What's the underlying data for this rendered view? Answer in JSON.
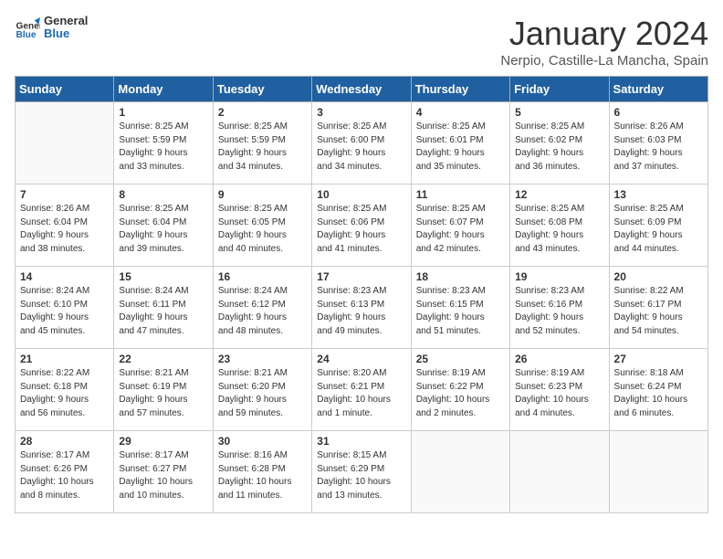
{
  "logo": {
    "text_general": "General",
    "text_blue": "Blue"
  },
  "title": "January 2024",
  "subtitle": "Nerpio, Castille-La Mancha, Spain",
  "headers": [
    "Sunday",
    "Monday",
    "Tuesday",
    "Wednesday",
    "Thursday",
    "Friday",
    "Saturday"
  ],
  "weeks": [
    [
      {
        "day": "",
        "info": ""
      },
      {
        "day": "1",
        "info": "Sunrise: 8:25 AM\nSunset: 5:59 PM\nDaylight: 9 hours\nand 33 minutes."
      },
      {
        "day": "2",
        "info": "Sunrise: 8:25 AM\nSunset: 5:59 PM\nDaylight: 9 hours\nand 34 minutes."
      },
      {
        "day": "3",
        "info": "Sunrise: 8:25 AM\nSunset: 6:00 PM\nDaylight: 9 hours\nand 34 minutes."
      },
      {
        "day": "4",
        "info": "Sunrise: 8:25 AM\nSunset: 6:01 PM\nDaylight: 9 hours\nand 35 minutes."
      },
      {
        "day": "5",
        "info": "Sunrise: 8:25 AM\nSunset: 6:02 PM\nDaylight: 9 hours\nand 36 minutes."
      },
      {
        "day": "6",
        "info": "Sunrise: 8:26 AM\nSunset: 6:03 PM\nDaylight: 9 hours\nand 37 minutes."
      }
    ],
    [
      {
        "day": "7",
        "info": "Sunrise: 8:26 AM\nSunset: 6:04 PM\nDaylight: 9 hours\nand 38 minutes."
      },
      {
        "day": "8",
        "info": "Sunrise: 8:25 AM\nSunset: 6:04 PM\nDaylight: 9 hours\nand 39 minutes."
      },
      {
        "day": "9",
        "info": "Sunrise: 8:25 AM\nSunset: 6:05 PM\nDaylight: 9 hours\nand 40 minutes."
      },
      {
        "day": "10",
        "info": "Sunrise: 8:25 AM\nSunset: 6:06 PM\nDaylight: 9 hours\nand 41 minutes."
      },
      {
        "day": "11",
        "info": "Sunrise: 8:25 AM\nSunset: 6:07 PM\nDaylight: 9 hours\nand 42 minutes."
      },
      {
        "day": "12",
        "info": "Sunrise: 8:25 AM\nSunset: 6:08 PM\nDaylight: 9 hours\nand 43 minutes."
      },
      {
        "day": "13",
        "info": "Sunrise: 8:25 AM\nSunset: 6:09 PM\nDaylight: 9 hours\nand 44 minutes."
      }
    ],
    [
      {
        "day": "14",
        "info": "Sunrise: 8:24 AM\nSunset: 6:10 PM\nDaylight: 9 hours\nand 45 minutes."
      },
      {
        "day": "15",
        "info": "Sunrise: 8:24 AM\nSunset: 6:11 PM\nDaylight: 9 hours\nand 47 minutes."
      },
      {
        "day": "16",
        "info": "Sunrise: 8:24 AM\nSunset: 6:12 PM\nDaylight: 9 hours\nand 48 minutes."
      },
      {
        "day": "17",
        "info": "Sunrise: 8:23 AM\nSunset: 6:13 PM\nDaylight: 9 hours\nand 49 minutes."
      },
      {
        "day": "18",
        "info": "Sunrise: 8:23 AM\nSunset: 6:15 PM\nDaylight: 9 hours\nand 51 minutes."
      },
      {
        "day": "19",
        "info": "Sunrise: 8:23 AM\nSunset: 6:16 PM\nDaylight: 9 hours\nand 52 minutes."
      },
      {
        "day": "20",
        "info": "Sunrise: 8:22 AM\nSunset: 6:17 PM\nDaylight: 9 hours\nand 54 minutes."
      }
    ],
    [
      {
        "day": "21",
        "info": "Sunrise: 8:22 AM\nSunset: 6:18 PM\nDaylight: 9 hours\nand 56 minutes."
      },
      {
        "day": "22",
        "info": "Sunrise: 8:21 AM\nSunset: 6:19 PM\nDaylight: 9 hours\nand 57 minutes."
      },
      {
        "day": "23",
        "info": "Sunrise: 8:21 AM\nSunset: 6:20 PM\nDaylight: 9 hours\nand 59 minutes."
      },
      {
        "day": "24",
        "info": "Sunrise: 8:20 AM\nSunset: 6:21 PM\nDaylight: 10 hours\nand 1 minute."
      },
      {
        "day": "25",
        "info": "Sunrise: 8:19 AM\nSunset: 6:22 PM\nDaylight: 10 hours\nand 2 minutes."
      },
      {
        "day": "26",
        "info": "Sunrise: 8:19 AM\nSunset: 6:23 PM\nDaylight: 10 hours\nand 4 minutes."
      },
      {
        "day": "27",
        "info": "Sunrise: 8:18 AM\nSunset: 6:24 PM\nDaylight: 10 hours\nand 6 minutes."
      }
    ],
    [
      {
        "day": "28",
        "info": "Sunrise: 8:17 AM\nSunset: 6:26 PM\nDaylight: 10 hours\nand 8 minutes."
      },
      {
        "day": "29",
        "info": "Sunrise: 8:17 AM\nSunset: 6:27 PM\nDaylight: 10 hours\nand 10 minutes."
      },
      {
        "day": "30",
        "info": "Sunrise: 8:16 AM\nSunset: 6:28 PM\nDaylight: 10 hours\nand 11 minutes."
      },
      {
        "day": "31",
        "info": "Sunrise: 8:15 AM\nSunset: 6:29 PM\nDaylight: 10 hours\nand 13 minutes."
      },
      {
        "day": "",
        "info": ""
      },
      {
        "day": "",
        "info": ""
      },
      {
        "day": "",
        "info": ""
      }
    ]
  ]
}
